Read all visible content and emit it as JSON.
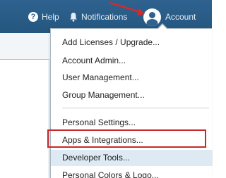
{
  "header": {
    "help_label": "Help",
    "notifications_label": "Notifications",
    "account_label": "Account",
    "help_glyph": "?"
  },
  "colors": {
    "header_bg": "#2f628f",
    "highlight_border": "#c8282c",
    "hover_row": "#dde9f3",
    "annotation_arrow": "#d42a2a"
  },
  "icons": {
    "help": "help-circle-icon",
    "notifications": "bell-icon",
    "account": "user-avatar-icon"
  },
  "account_menu": {
    "items": [
      "Add Licenses / Upgrade...",
      "Account Admin...",
      "User Management...",
      "Group Management...",
      "Personal Settings...",
      "Apps & Integrations...",
      "Developer Tools...",
      "Personal Colors & Logo..."
    ],
    "highlighted_item": "Apps & Integrations...",
    "hovered_item": "Developer Tools..."
  }
}
